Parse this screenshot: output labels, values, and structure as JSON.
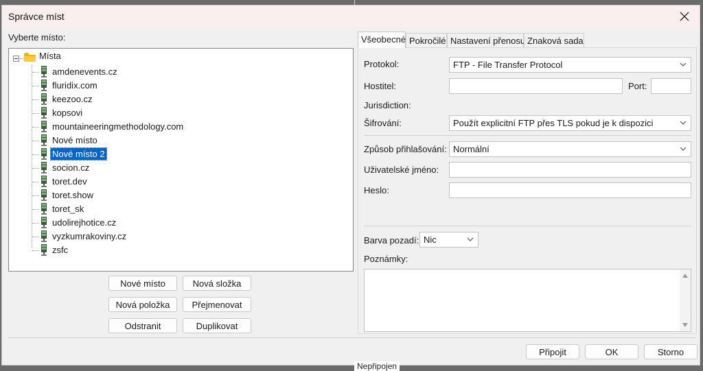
{
  "background": {
    "text": "Nepřipojen"
  },
  "window": {
    "title": "Správce míst"
  },
  "left": {
    "select_label": "Vyberte místo:",
    "root_label": "Místa",
    "items": [
      "amdenevents.cz",
      "fluridix.com",
      "keezoo.cz",
      "kopsovi",
      "mountaineeringmethodology.com",
      "Nové místo",
      "Nové místo 2",
      "socion.cz",
      "toret.dev",
      "toret.show",
      "toret_sk",
      "udolirejhotice.cz",
      "vyzkumrakoviny.cz",
      "zsfc"
    ],
    "selected_item": "Nové místo 2",
    "buttons": {
      "new_site": "Nové místo",
      "new_folder": "Nová složka",
      "new_item": "Nová položka",
      "rename": "Přejmenovat",
      "delete": "Odstranit",
      "duplicate": "Duplikovat"
    }
  },
  "tabs": [
    "Všeobecné",
    "Pokročilé",
    "Nastavení přenosu",
    "Znaková sada"
  ],
  "general": {
    "protocol_label": "Protokol:",
    "protocol_value": "FTP - File Transfer Protocol",
    "host_label": "Hostitel:",
    "host_value": "",
    "port_label": "Port:",
    "port_value": "",
    "jurisdiction_label": "Jurisdiction:",
    "encryption_label": "Šifrování:",
    "encryption_value": "Použít explicitní FTP přes TLS pokud je k dispozici",
    "login_label": "Způsob přihlašování:",
    "login_value": "Normální",
    "user_label": "Uživatelské jméno:",
    "user_value": "",
    "password_label": "Heslo:",
    "password_value": "",
    "bgcolor_label": "Barva pozadí:",
    "bgcolor_value": "Nic",
    "notes_label": "Poznámky:"
  },
  "footer": {
    "connect": "Připojit",
    "ok": "OK",
    "cancel": "Storno"
  },
  "colors": {
    "selection": "#0066cc",
    "folder": "#f5b400"
  }
}
